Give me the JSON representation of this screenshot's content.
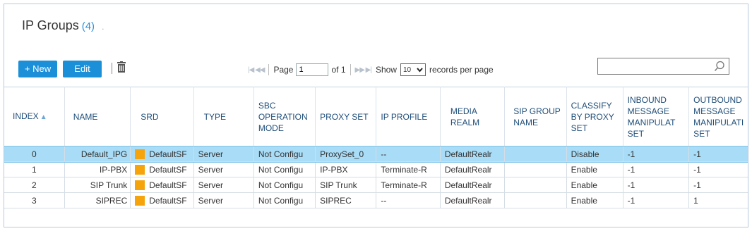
{
  "header": {
    "title": "IP Groups",
    "count": "(4)",
    "dot": "."
  },
  "toolbar": {
    "new_label": "+ New",
    "edit_label": "Edit"
  },
  "pager": {
    "first_prev": "|◀ ◀◀",
    "next_last": "▶▶ ▶|",
    "page_label": "Page",
    "page_value": "1",
    "of_label": "of 1",
    "show_label": "Show",
    "records_value": "10",
    "records_label": "records per page"
  },
  "search": {
    "value": ""
  },
  "table": {
    "columns": [
      {
        "label": "INDEX",
        "sort": "▲"
      },
      {
        "label": "NAME"
      },
      {
        "label": "SRD"
      },
      {
        "label": "TYPE"
      },
      {
        "label": "SBC OPERATION MODE"
      },
      {
        "label": "PROXY SET"
      },
      {
        "label": "IP PROFILE"
      },
      {
        "label": "MEDIA REALM"
      },
      {
        "label": "SIP GROUP NAME"
      },
      {
        "label": "CLASSIFY BY PROXY SET"
      },
      {
        "label": "INBOUND MESSAGE MANIPULAT SET"
      },
      {
        "label": "OUTBOUND MESSAGE MANIPULATI SET"
      }
    ],
    "rows": [
      {
        "index": "0",
        "name": "Default_IPG",
        "srd": "DefaultSF",
        "type": "Server",
        "mode": "Not Configu",
        "proxy": "ProxySet_0",
        "ipprofile": "--",
        "realm": "DefaultRealr",
        "sipgroup": "",
        "classify": "Disable",
        "inbound": "-1",
        "outbound": "-1"
      },
      {
        "index": "1",
        "name": "IP-PBX",
        "srd": "DefaultSF",
        "type": "Server",
        "mode": "Not Configu",
        "proxy": "IP-PBX",
        "ipprofile": "Terminate-R",
        "realm": "DefaultRealr",
        "sipgroup": "",
        "classify": "Enable",
        "inbound": "-1",
        "outbound": "-1"
      },
      {
        "index": "2",
        "name": "SIP Trunk",
        "srd": "DefaultSF",
        "type": "Server",
        "mode": "Not Configu",
        "proxy": "SIP Trunk",
        "ipprofile": "Terminate-R",
        "realm": "DefaultRealr",
        "sipgroup": "",
        "classify": "Enable",
        "inbound": "-1",
        "outbound": "-1"
      },
      {
        "index": "3",
        "name": "SIPREC",
        "srd": "DefaultSF",
        "type": "Server",
        "mode": "Not Configu",
        "proxy": "SIPREC",
        "ipprofile": "--",
        "realm": "DefaultRealr",
        "sipgroup": "",
        "classify": "Enable",
        "inbound": "-1",
        "outbound": "1"
      }
    ],
    "selected_row": 0
  },
  "colors": {
    "accent": "#1b8fd8",
    "selected_row": "#a9dcf6",
    "srd_square": "#f6a40b",
    "header_text": "#1f4e79"
  },
  "icons": [
    "trash-icon",
    "search-icon",
    "sort-up-icon",
    "chevron-down-icon",
    "first-page-icon",
    "prev-page-icon",
    "next-page-icon",
    "last-page-icon",
    "srd-color-icon"
  ]
}
